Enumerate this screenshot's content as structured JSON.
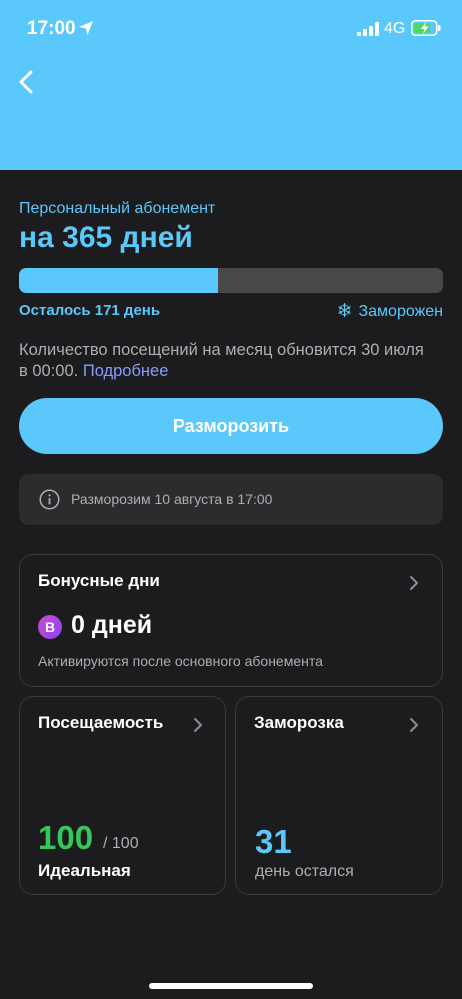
{
  "status_bar": {
    "time": "17:00",
    "network": "4G",
    "icons": [
      "location-arrow-icon",
      "signal-icon",
      "battery-charging-icon"
    ]
  },
  "colors": {
    "accent": "#5ac8fa",
    "background": "#1c1c1e",
    "success": "#34c759",
    "link": "#8a9bff",
    "bonus_badge": "#b04ae0"
  },
  "subscription": {
    "type": "Персональный абонемент",
    "duration": "на 365 дней",
    "progress_fraction": 0.47,
    "remaining": "Осталось 171 день",
    "status": "Заморожен",
    "visits_info": "Количество посещений на месяц обновится 30 июля в 00:00.",
    "more_link": "Подробнее"
  },
  "actions": {
    "unfreeze_label": "Разморозить"
  },
  "notice": {
    "text": "Разморозим 10 августа в 17:00",
    "icon": "info-icon"
  },
  "bonus_card": {
    "title": "Бонусные дни",
    "badge": "B",
    "value": "0 дней",
    "note": "Активируются после основного абонемента"
  },
  "attendance_card": {
    "title": "Посещаемость",
    "score": "100",
    "score_max": "/ 100",
    "label": "Идеальная"
  },
  "freeze_card": {
    "title": "Заморозка",
    "days": "31",
    "label": "день остался"
  }
}
